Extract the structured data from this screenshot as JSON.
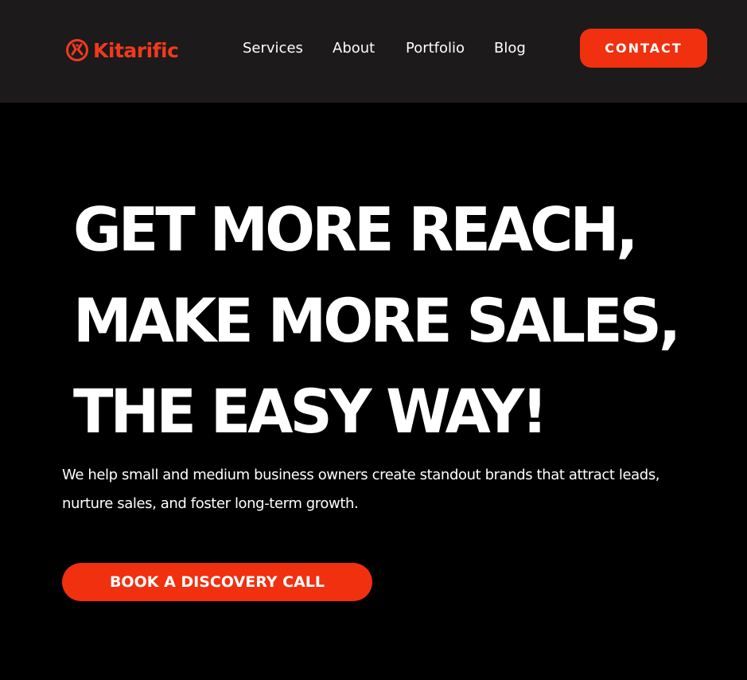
{
  "brand": {
    "name": "Kitarific",
    "logo_icon": "kitarific-logo-icon",
    "color": "#f03a1c"
  },
  "nav": {
    "items": [
      {
        "label": "Services"
      },
      {
        "label": "About"
      },
      {
        "label": "Portfolio"
      },
      {
        "label": "Blog"
      }
    ],
    "contact_label": "CONTACT"
  },
  "hero": {
    "title_lines": [
      "GET MORE REACH,",
      "MAKE MORE SALES,",
      "THE EASY WAY!"
    ],
    "subtitle": "We help small and medium business owners create standout brands that attract leads, nurture sales, and foster long-term growth.",
    "cta_label": "BOOK A DISCOVERY CALL"
  },
  "colors": {
    "accent": "#f0300f",
    "header_bg": "#1c1a1b",
    "page_bg": "#000000",
    "text": "#ffffff"
  }
}
